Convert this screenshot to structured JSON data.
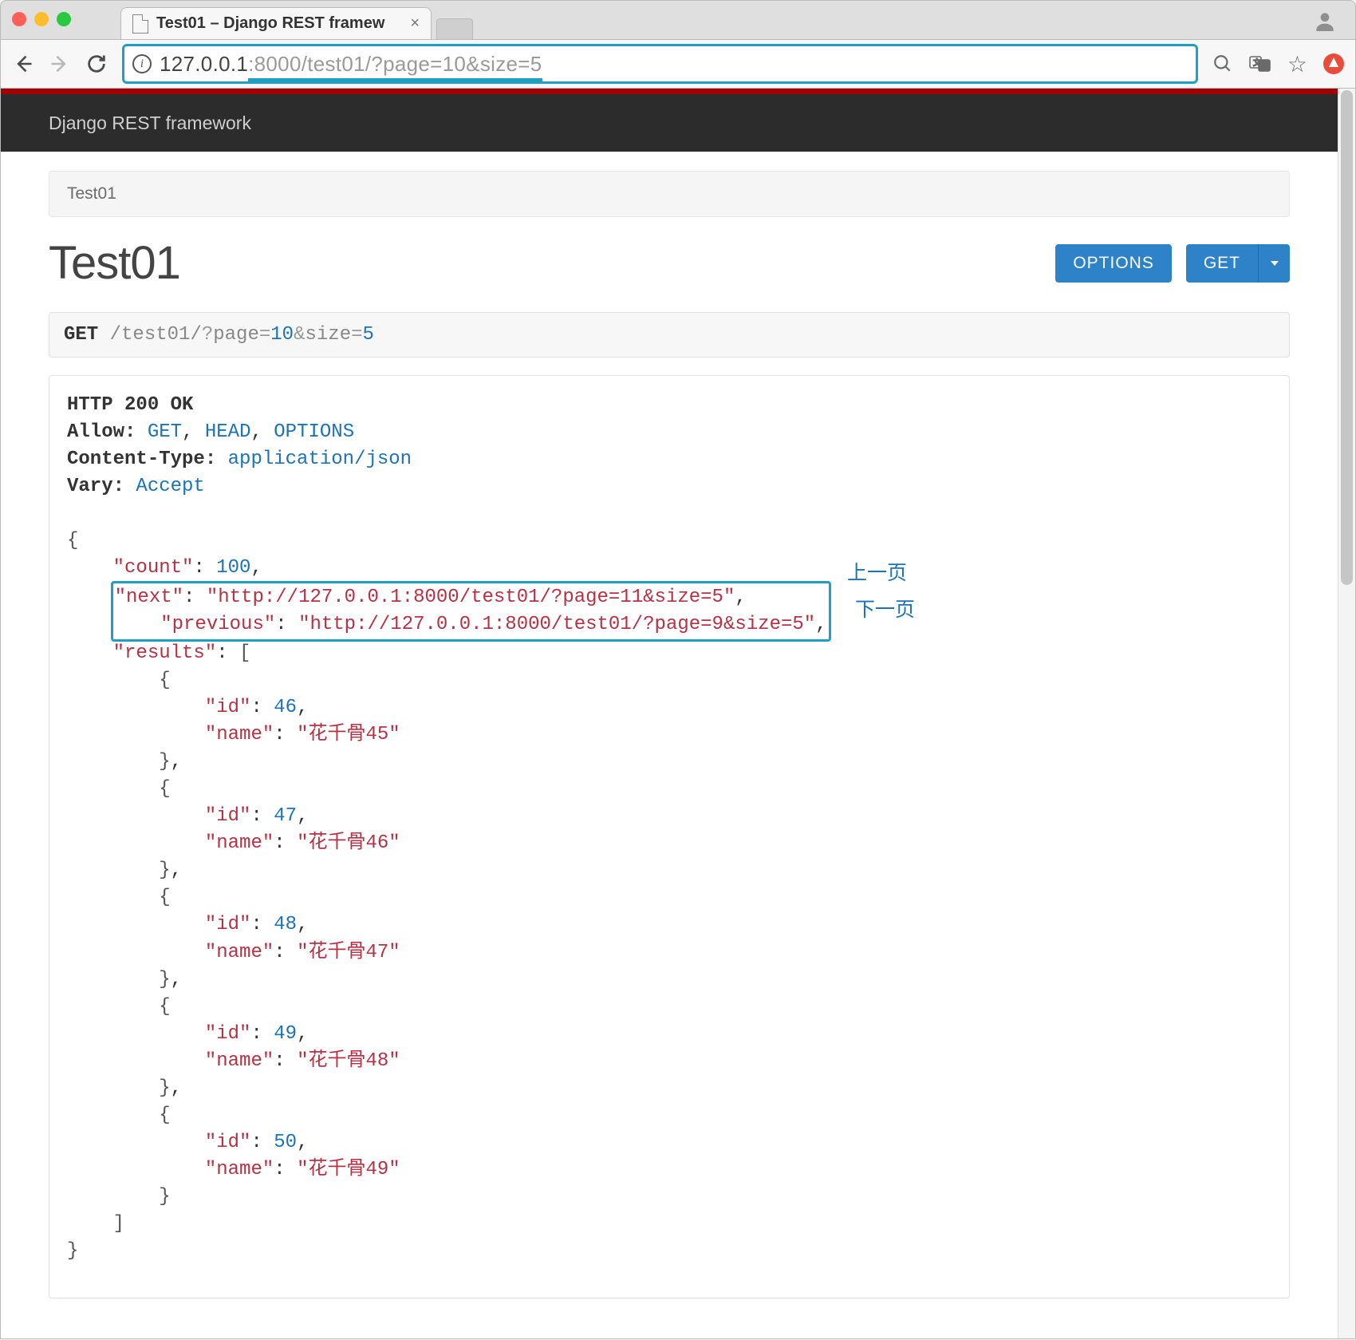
{
  "browser": {
    "tab_title": "Test01 – Django REST framew",
    "address_host": "127.0.0.1",
    "address_path": ":8000/test01/?page=10&size=5"
  },
  "drf": {
    "brand": "Django REST framework",
    "breadcrumb": "Test01",
    "page_title": "Test01",
    "options_label": "OPTIONS",
    "get_label": "GET"
  },
  "request": {
    "method": "GET",
    "path": "/test01/",
    "page_param": "page",
    "page_value": "10",
    "size_param": "size",
    "size_value": "5"
  },
  "response": {
    "status_line": "HTTP 200 OK",
    "headers": {
      "allow_key": "Allow:",
      "allow_values": [
        "GET",
        "HEAD",
        "OPTIONS"
      ],
      "ctype_key": "Content-Type:",
      "ctype_value": "application/json",
      "vary_key": "Vary:",
      "vary_value": "Accept"
    },
    "body": {
      "count": 100,
      "next": "http://127.0.0.1:8000/test01/?page=11&size=5",
      "previous": "http://127.0.0.1:8000/test01/?page=9&size=5",
      "results": [
        {
          "id": 46,
          "name": "花千骨45"
        },
        {
          "id": 47,
          "name": "花千骨46"
        },
        {
          "id": 48,
          "name": "花千骨47"
        },
        {
          "id": 49,
          "name": "花千骨48"
        },
        {
          "id": 50,
          "name": "花千骨49"
        }
      ]
    }
  },
  "annotations": {
    "prev_page": "上一页",
    "next_page": "下一页"
  }
}
